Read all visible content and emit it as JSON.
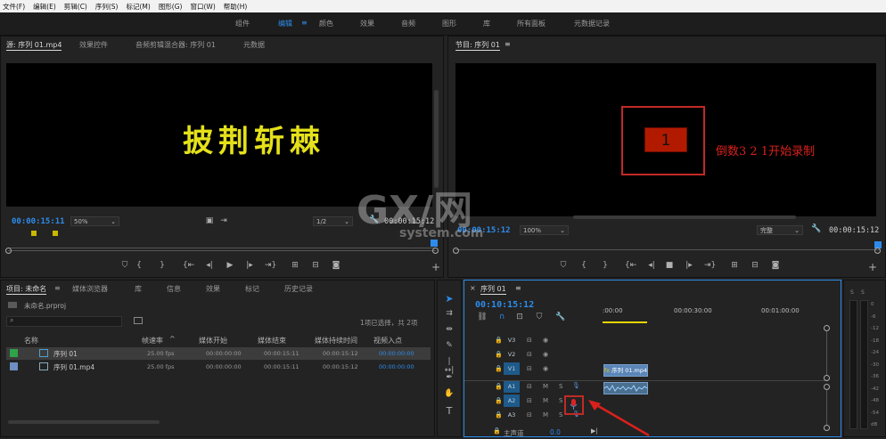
{
  "menu": [
    "文件(F)",
    "编辑(E)",
    "剪辑(C)",
    "序列(S)",
    "标记(M)",
    "图形(G)",
    "窗口(W)",
    "帮助(H)"
  ],
  "workspaces": [
    "组件",
    "编辑",
    "颜色",
    "效果",
    "音频",
    "图形",
    "库",
    "所有面板",
    "元数据记录"
  ],
  "workspace_menu_icon": "≡",
  "source": {
    "tabs": [
      "源: 序列 01.mp4",
      "效果控件",
      "音频剪辑混合器: 序列 01",
      "元数据"
    ],
    "title_text": "披荆斩棘",
    "title_color": "#e4e11a",
    "timecode": "00:00:15:11",
    "zoom": "50%",
    "resolution": "1/2",
    "duration": "00:00:15:12"
  },
  "program": {
    "tab": "节目: 序列 01",
    "countdown_number": "1",
    "countdown_color": "#b21a00",
    "annotation": "倒数3 2 1开始录制",
    "annotation_color": "#d8211c",
    "timecode": "00:00:15:12",
    "zoom": "100%",
    "quality": "完整",
    "duration": "00:00:15:12"
  },
  "watermark": {
    "big": "GX/网",
    "small": "system.com"
  },
  "project": {
    "tabs": [
      "项目: 未命名",
      "媒体浏览器",
      "库",
      "信息",
      "效果",
      "标记",
      "历史记录"
    ],
    "file": "未命名.prproj",
    "selection_info": "1项已选择，共 2项",
    "columns": [
      "名称",
      "帧速率",
      "媒体开始",
      "媒体结束",
      "媒体持续时间",
      "视频入点"
    ],
    "rows": [
      {
        "name": "序列 01",
        "fps": "25.00 fps",
        "start": "00:00:00:00",
        "end": "00:00:15:11",
        "dur": "00:00:15:12",
        "in": "00:00:00:00",
        "color": "#2fa24a",
        "selected": true
      },
      {
        "name": "序列 01.mp4",
        "fps": "25.00 fps",
        "start": "00:00:00:00",
        "end": "00:00:15:11",
        "dur": "00:00:15:12",
        "in": "00:00:00:00",
        "color": "#6e8fc2",
        "selected": false
      }
    ]
  },
  "timeline": {
    "tab": "序列 01",
    "timecode": "00:10:15:12",
    "ruler": [
      ":00:00",
      "00:00:30:00",
      "00:01:00:00"
    ],
    "video_tracks": [
      "V3",
      "V2",
      "V1"
    ],
    "audio_tracks": [
      "A1",
      "A2",
      "A3"
    ],
    "master_label": "主声道",
    "master_value": "0.0",
    "clip_video": "序列 01.mp4",
    "clip_fx": "fx"
  },
  "meter": {
    "ticks": [
      "0",
      "-6",
      "-12",
      "-18",
      "-24",
      "-30",
      "-36",
      "-42",
      "-48",
      "-54",
      "dB"
    ],
    "labels": [
      "S",
      "S"
    ]
  }
}
